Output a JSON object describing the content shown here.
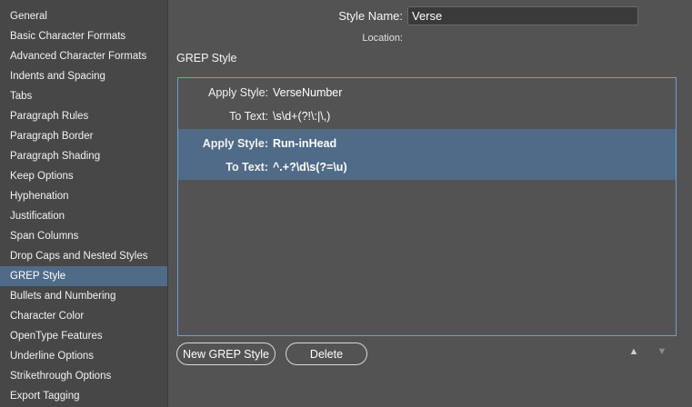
{
  "sidebar": {
    "items": [
      {
        "label": "General"
      },
      {
        "label": "Basic Character Formats"
      },
      {
        "label": "Advanced Character Formats"
      },
      {
        "label": "Indents and Spacing"
      },
      {
        "label": "Tabs"
      },
      {
        "label": "Paragraph Rules"
      },
      {
        "label": "Paragraph Border"
      },
      {
        "label": "Paragraph Shading"
      },
      {
        "label": "Keep Options"
      },
      {
        "label": "Hyphenation"
      },
      {
        "label": "Justification"
      },
      {
        "label": "Span Columns"
      },
      {
        "label": "Drop Caps and Nested Styles"
      },
      {
        "label": "GREP Style"
      },
      {
        "label": "Bullets and Numbering"
      },
      {
        "label": "Character Color"
      },
      {
        "label": "OpenType Features"
      },
      {
        "label": "Underline Options"
      },
      {
        "label": "Strikethrough Options"
      },
      {
        "label": "Export Tagging"
      }
    ],
    "selected_label": "GREP Style"
  },
  "header": {
    "style_name_label": "Style Name:",
    "style_name_value": "Verse",
    "location_label": "Location:"
  },
  "section": {
    "title": "GREP Style"
  },
  "grep_rules": [
    {
      "apply_style_label": "Apply Style:",
      "apply_style_value": "VerseNumber",
      "to_text_label": "To Text:",
      "to_text_value": "\\s\\d+(?!\\:|\\,)",
      "selected": false
    },
    {
      "apply_style_label": "Apply Style:",
      "apply_style_value": "Run-inHead",
      "to_text_label": "To Text:",
      "to_text_value": "^.+?\\d\\s(?=\\u)",
      "selected": true
    }
  ],
  "buttons": {
    "new_grep_style": "New GREP Style",
    "delete": "Delete",
    "move_up": "▲",
    "move_down": "▼"
  },
  "colors": {
    "background": "#535353",
    "sidebar_background": "#474747",
    "selection": "#506b87",
    "list_border": "#6aa0d4"
  },
  "icons": {
    "move_up": "triangle-up-icon",
    "move_down": "triangle-down-icon"
  }
}
